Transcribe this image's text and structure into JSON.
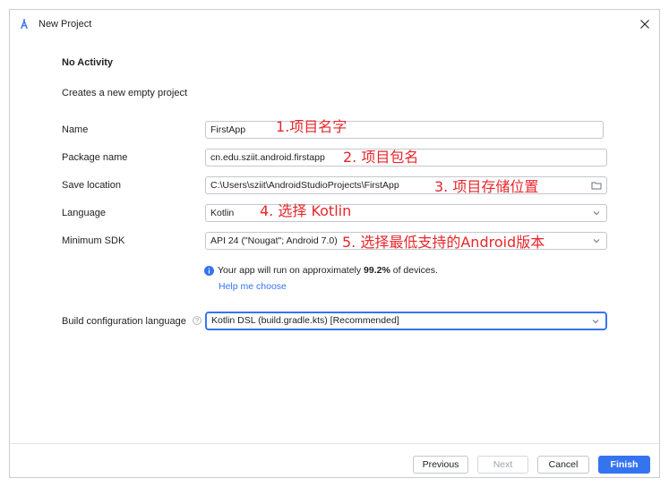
{
  "window": {
    "title": "New Project",
    "app_icon": "android-studio-icon",
    "close_icon": "close-icon"
  },
  "page": {
    "heading": "No Activity",
    "description": "Creates a new empty project"
  },
  "form": {
    "name": {
      "label": "Name",
      "value": "FirstApp"
    },
    "package_name": {
      "label": "Package name",
      "value": "cn.edu.sziit.android.firstapp"
    },
    "save_location": {
      "label": "Save location",
      "value": "C:\\Users\\sziit\\AndroidStudioProjects\\FirstApp",
      "icon": "folder-icon"
    },
    "language": {
      "label": "Language",
      "value": "Kotlin",
      "icon": "chevron-down-icon"
    },
    "minimum_sdk": {
      "label": "Minimum SDK",
      "value": "API 24 (\"Nougat\"; Android 7.0)",
      "icon": "chevron-down-icon"
    },
    "build_config": {
      "label": "Build configuration language",
      "value": "Kotlin DSL (build.gradle.kts) [Recommended]",
      "icon": "chevron-down-icon"
    }
  },
  "info": {
    "prefix": "Your app will run on approximately ",
    "percent": "99.2%",
    "suffix": " of devices.",
    "help_link": "Help me choose"
  },
  "annotations": {
    "a1": "1.项目名字",
    "a2": "2. 项目包名",
    "a3": "3. 项目存储位置",
    "a4": "4. 选择 Kotlin",
    "a5": "5. 选择最低支持的Android版本"
  },
  "footer": {
    "previous": "Previous",
    "next": "Next",
    "cancel": "Cancel",
    "finish": "Finish"
  },
  "colors": {
    "accent": "#3574f0",
    "annotation": "#e8262b"
  }
}
